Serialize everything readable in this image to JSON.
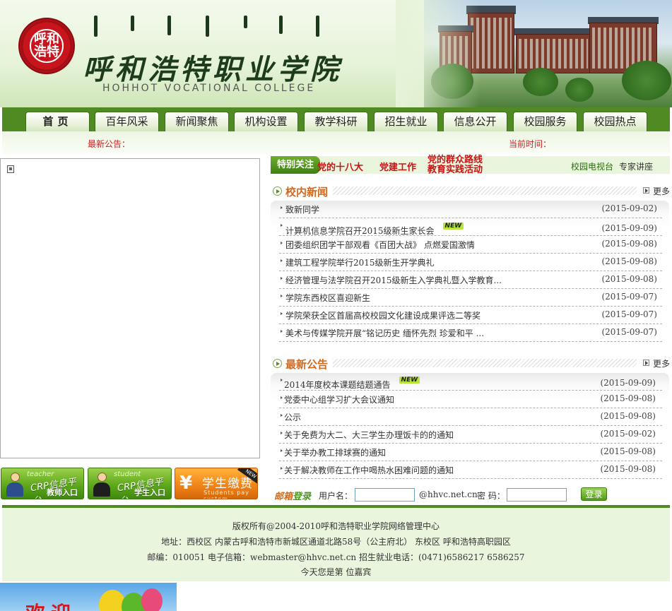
{
  "header": {
    "seal_text": "呼和浩特",
    "school_name_cn": "呼和浩特职业学院",
    "school_name_en": "HOHHOT  VOCATIONAL  COLLEGE"
  },
  "nav": {
    "items": [
      "首页",
      "百年风采",
      "新闻聚焦",
      "机构设置",
      "教学科研",
      "招生就业",
      "信息公开",
      "校园服务",
      "校园热点"
    ]
  },
  "noticebar": {
    "notice_label": "最新公告：",
    "time_label": "当前时间："
  },
  "special": {
    "tag": "特别关注",
    "link1": "党的十八大",
    "link2": "党建工作",
    "link3a": "党的群众路线",
    "link3b": "教育实践活动",
    "link4": "校园电视台",
    "link5": "专家讲座"
  },
  "news": {
    "title": "校内新闻",
    "more": "更多",
    "new_badge": "NEW",
    "items": [
      {
        "text": "致新同学",
        "date": "(2015-09-02)"
      },
      {
        "text": "计算机信息学院召开2015级新生家长会",
        "date": "(2015-09-09)"
      },
      {
        "text": "团委组织团学干部观看《百团大战》 点燃爱国激情",
        "date": "(2015-09-08)"
      },
      {
        "text": "建筑工程学院举行2015级新生开学典礼",
        "date": "(2015-09-08)"
      },
      {
        "text": "经济管理与法学院召开2015级新生入学典礼暨入学教育...",
        "date": "(2015-09-08)"
      },
      {
        "text": "学院东西校区喜迎新生",
        "date": "(2015-09-07)"
      },
      {
        "text": "学院荣获全区首届高校校园文化建设成果评选二等奖",
        "date": "(2015-09-07)"
      },
      {
        "text": "美术与传媒学院开展“铭记历史 缅怀先烈 珍爱和平 ...",
        "date": "(2015-09-07)"
      }
    ]
  },
  "notices": {
    "title": "最新公告",
    "more": "更多",
    "new_badge": "NEW",
    "items": [
      {
        "text": "2014年度校本课题结题通告",
        "date": "(2015-09-09)"
      },
      {
        "text": "党委中心组学习扩大会议通知",
        "date": "(2015-09-08)"
      },
      {
        "text": "公示",
        "date": "(2015-09-08)"
      },
      {
        "text": "关于免费为大二、大三学生办理饭卡的的通知",
        "date": "(2015-09-02)"
      },
      {
        "text": "关于举办教工排球赛的通知",
        "date": "(2015-09-08)"
      },
      {
        "text": "关于解决教师在工作中喝热水困难问题的通知",
        "date": "(2015-09-08)"
      }
    ]
  },
  "portals": {
    "teacher_tag": "teacher",
    "teacher_l1": "CRP信息平台",
    "teacher_l2": "教师入口",
    "student_tag": "student",
    "student_l1": "CRP信息平台",
    "student_l2": "学生入口",
    "pay_label": "学生缴费",
    "pay_sub": "Students pay system",
    "pay_ribbon": "NEW"
  },
  "login": {
    "brand_a": "邮箱",
    "brand_b": "登录",
    "user_label": "用户名：",
    "domain": "@hhvc.net.cn",
    "pwd_label": "密  码：",
    "button": "登录"
  },
  "footer": {
    "line1": "版权所有@2004-2010呼和浩特职业学院网络管理中心",
    "line2": "地址：西校区  内蒙古呼和浩特市新城区通道北路58号（公主府北）  东校区  呼和浩特高职园区",
    "line3": "邮编：010051 电子信箱：webmaster@hhvc.net.cn 招生就业电话：(0471)6586217 6586257",
    "line4": "今天您是第                  位嘉宾"
  },
  "welcome": {
    "text": "欢迎"
  }
}
